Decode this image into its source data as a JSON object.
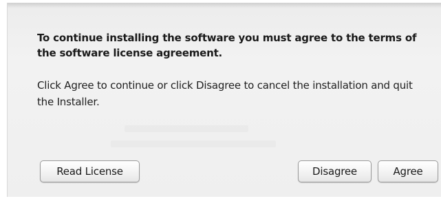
{
  "dialog": {
    "message": "To continue installing the software you must agree to the terms of the software license agreement.",
    "informative_text": "Click Agree to continue or click Disagree to cancel the installation and quit the Installer."
  },
  "buttons": {
    "read_license": "Read License",
    "disagree": "Disagree",
    "agree": "Agree"
  }
}
